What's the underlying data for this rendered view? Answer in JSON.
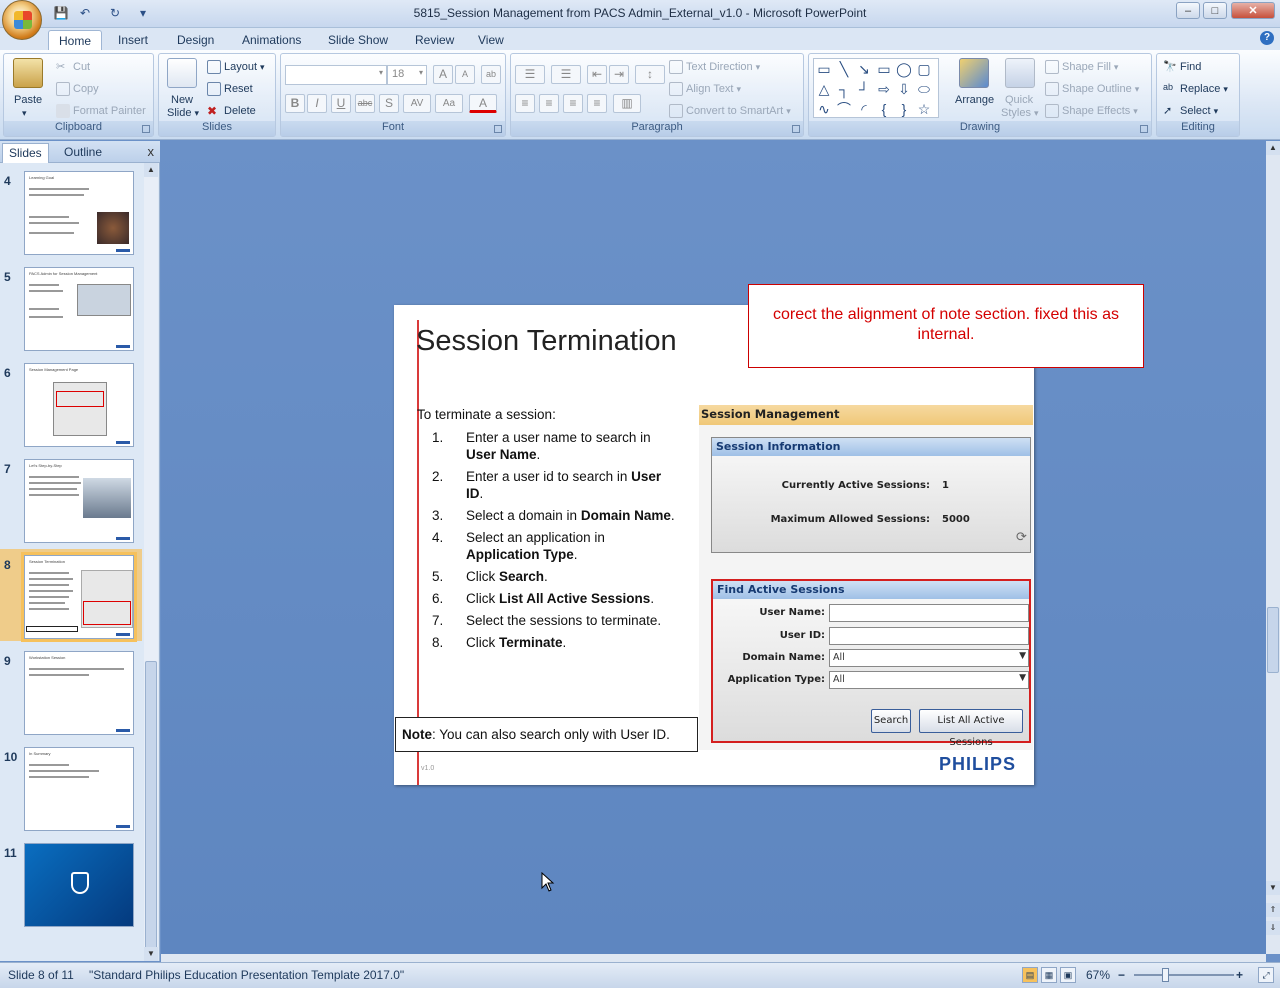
{
  "window": {
    "title": "5815_Session Management from PACS Admin_External_v1.0 - Microsoft PowerPoint",
    "minimize": "–",
    "maximize": "□",
    "close": "✕"
  },
  "qat": {
    "save_icon": "💾",
    "undo_icon": "↶",
    "redo_icon": "↻",
    "customize_icon": "▾"
  },
  "tabs": [
    "Home",
    "Insert",
    "Design",
    "Animations",
    "Slide Show",
    "Review",
    "View"
  ],
  "help": "?",
  "ribbon": {
    "clipboard": {
      "label": "Clipboard",
      "paste": "Paste",
      "cut": "Cut",
      "copy": "Copy",
      "format_painter": "Format Painter"
    },
    "slides": {
      "label": "Slides",
      "new_slide_1": "New",
      "new_slide_2": "Slide",
      "layout": "Layout",
      "reset": "Reset",
      "delete": "Delete"
    },
    "font": {
      "label": "Font",
      "font_name": "",
      "font_size": "18",
      "bold": "B",
      "italic": "I",
      "underline": "U",
      "strike": "abc",
      "shadow": "S",
      "spacing": "AV",
      "case": "Aa",
      "color": "A",
      "grow": "A",
      "shrink": "A",
      "clear": "ab"
    },
    "paragraph": {
      "label": "Paragraph",
      "text_direction": "Text Direction",
      "align_text": "Align Text",
      "convert_smartart": "Convert to SmartArt"
    },
    "drawing": {
      "label": "Drawing",
      "arrange": "Arrange",
      "quick_styles_1": "Quick",
      "quick_styles_2": "Styles",
      "shape_fill": "Shape Fill",
      "shape_outline": "Shape Outline",
      "shape_effects": "Shape Effects"
    },
    "editing": {
      "label": "Editing",
      "find": "Find",
      "replace": "Replace",
      "select": "Select"
    }
  },
  "pane": {
    "tabs": [
      "Slides",
      "Outline"
    ],
    "close": "x",
    "thumbnails": [
      {
        "number": "4",
        "title": "Learning Goal"
      },
      {
        "number": "5",
        "title": "PACS Admin for Session Management"
      },
      {
        "number": "6",
        "title": "Session Management Page"
      },
      {
        "number": "7",
        "title": "Let's Step-by-Step"
      },
      {
        "number": "8",
        "title": "Session Termination"
      },
      {
        "number": "9",
        "title": "Workstation Session"
      },
      {
        "number": "10",
        "title": "In Summary"
      },
      {
        "number": "11",
        "title": ""
      }
    ]
  },
  "slide": {
    "title": "Session Termination",
    "intro": "To terminate a session:",
    "steps": [
      {
        "n": "1.",
        "pre": "Enter a user name to search in ",
        "bold": "User Name",
        "post": "."
      },
      {
        "n": "2.",
        "pre": "Enter a user id to search in ",
        "bold": "User ID",
        "post": "."
      },
      {
        "n": "3.",
        "pre": "Select a domain in ",
        "bold": "Domain Name",
        "post": "."
      },
      {
        "n": "4.",
        "pre": "Select an application in ",
        "bold": "Application Type",
        "post": "."
      },
      {
        "n": "5.",
        "pre": "Click ",
        "bold": "Search",
        "post": "."
      },
      {
        "n": "6.",
        "pre": "Click ",
        "bold": "List All Active Sessions",
        "post": "."
      },
      {
        "n": "7.",
        "pre": "Select the sessions to terminate.",
        "bold": "",
        "post": ""
      },
      {
        "n": "8.",
        "pre": "Click ",
        "bold": "Terminate",
        "post": "."
      }
    ],
    "note_bold": "Note",
    "note_text": ": You can also search only with User ID.",
    "logo": "PHILIPS",
    "version": "v1.0",
    "embedded": {
      "header": "Session Management",
      "info_title": "Session Information",
      "active_label": "Currently Active Sessions:",
      "active_value": "1",
      "max_label": "Maximum Allowed Sessions:",
      "max_value": "5000",
      "find_title": "Find Active Sessions",
      "user_name_label": "User Name:",
      "user_id_label": "User ID:",
      "domain_label": "Domain Name:",
      "domain_value": "All",
      "app_label": "Application Type:",
      "app_value": "All",
      "search_btn": "Search",
      "list_btn": "List All Active Sessions"
    }
  },
  "comment": "corect the alignment of note section. fixed this as internal.",
  "status": {
    "slide_info": "Slide 8 of 11",
    "theme": "\"Standard Philips Education Presentation Template 2017.0\"",
    "zoom": "67%",
    "zoom_out": "−",
    "zoom_in": "+"
  }
}
